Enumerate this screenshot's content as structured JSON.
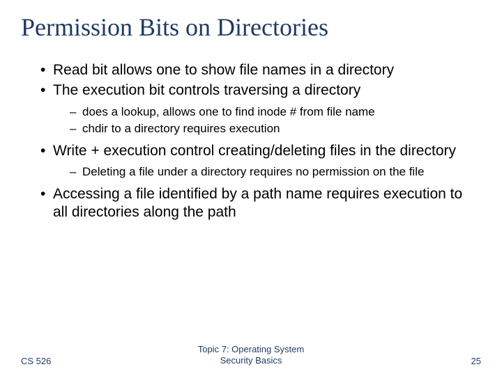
{
  "title": "Permission Bits on Directories",
  "bullets": {
    "b0": "Read bit allows one to show file names in a directory",
    "b1": "The execution bit controls traversing a directory",
    "b1_0": "does a lookup, allows one to find inode # from file name",
    "b1_1": "chdir to a directory requires execution",
    "b2": "Write + execution control creating/deleting files in the directory",
    "b2_0": "Deleting a file under a directory requires no permission on the file",
    "b3": "Accessing a file identified by a path name requires execution to all directories along the path"
  },
  "footer": {
    "left": "CS 526",
    "center_line1": "Topic 7: Operating System",
    "center_line2": "Security Basics",
    "right": "25"
  }
}
